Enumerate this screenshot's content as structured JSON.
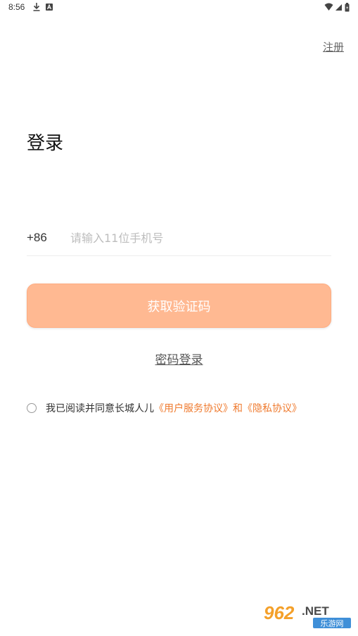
{
  "status_bar": {
    "time": "8:56"
  },
  "header": {
    "register_label": "注册"
  },
  "page_title": "登录",
  "phone": {
    "country_code": "+86",
    "placeholder": "请输入11位手机号"
  },
  "actions": {
    "get_code_label": "获取验证码",
    "password_login_label": "密码登录"
  },
  "agreement": {
    "prefix": "我已阅读并同意长城人儿",
    "user_agreement": "《用户服务协议》",
    "conjunction": "和",
    "privacy_policy": "《隐私协议》"
  },
  "watermark": {
    "number": "962",
    "domain": ".NET",
    "site_name": "乐游网"
  },
  "colors": {
    "button_bg": "#ffb992",
    "link_accent": "#ef7a2e"
  }
}
